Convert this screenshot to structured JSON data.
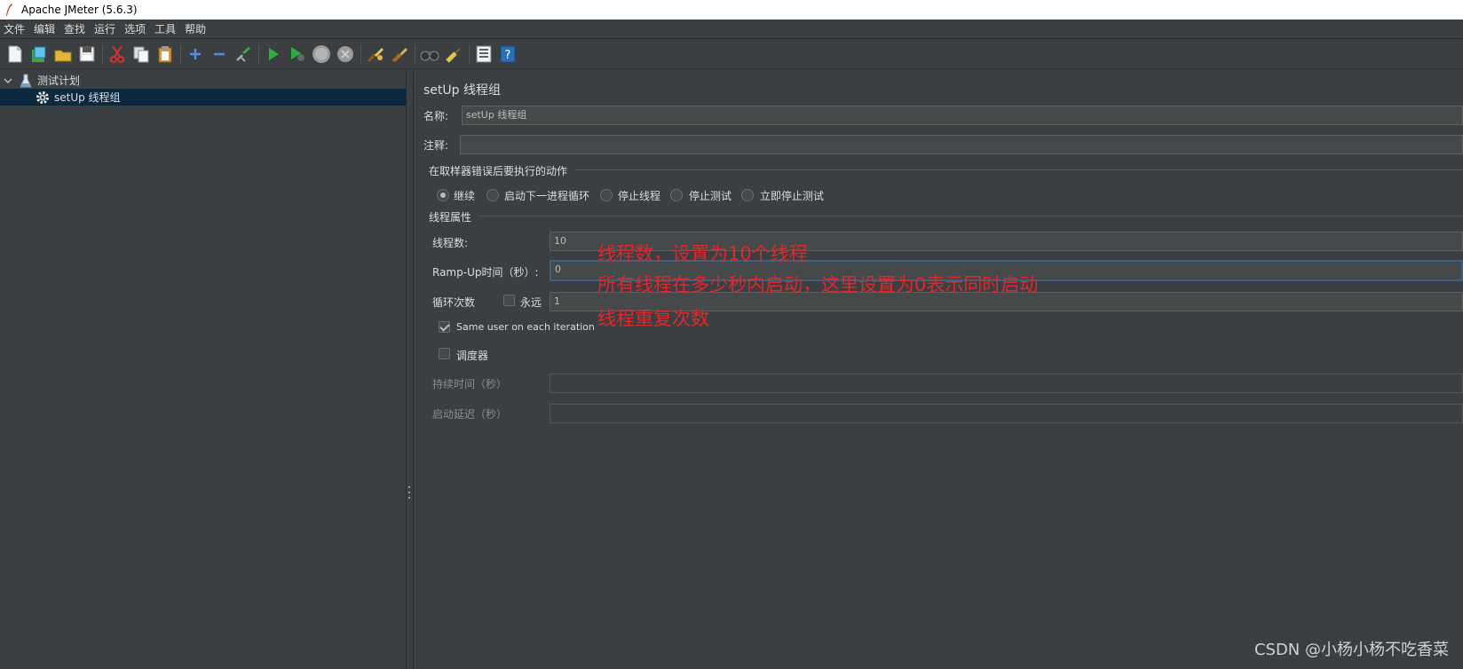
{
  "window": {
    "title": "Apache JMeter (5.6.3)"
  },
  "menubar": {
    "items": [
      "文件",
      "编辑",
      "查找",
      "运行",
      "选项",
      "工具",
      "帮助"
    ]
  },
  "toolbar": {
    "buttons": [
      "new-icon",
      "templates-icon",
      "open-icon",
      "save-icon",
      "cut-icon",
      "copy-icon",
      "paste-icon",
      "expand-icon",
      "collapse-icon",
      "toggle-icon",
      "start-icon",
      "start-no-pause-icon",
      "stop-icon",
      "shutdown-icon",
      "clear-icon",
      "clear-all-icon",
      "search-icon",
      "reset-search-icon",
      "function-helper-icon",
      "help-icon"
    ]
  },
  "tree": {
    "root_label": "测试计划",
    "child_label": "setUp 线程组"
  },
  "panel": {
    "title": "setUp 线程组",
    "name_label": "名称:",
    "name_value": "setUp 线程组",
    "comment_label": "注释:",
    "comment_value": "",
    "error_action_legend": "在取样器错误后要执行的动作",
    "error_actions": [
      "继续",
      "启动下一进程循环",
      "停止线程",
      "停止测试",
      "立即停止测试"
    ],
    "thread_props_legend": "线程属性",
    "threads_label": "线程数:",
    "threads_value": "10",
    "rampup_label": "Ramp-Up时间（秒）:",
    "rampup_value": "0",
    "loop_label": "循环次数",
    "forever_label": "永远",
    "loop_value": "1",
    "same_user_label": "Same user on each iteration",
    "scheduler_label": "调度器",
    "duration_label": "持续时间（秒）",
    "duration_value": "",
    "startup_delay_label": "启动延迟（秒）",
    "startup_delay_value": ""
  },
  "annotations": {
    "threads_note": "线程数，设置为10个线程",
    "rampup_note": "所有线程在多少秒内启动，这里设置为0表示同时启动",
    "loop_note": "线程重复次数"
  },
  "watermark": "CSDN @小杨小杨不吃香菜",
  "colors": {
    "background": "#3c3f41",
    "selection": "#0d293e",
    "annotation": "#e0282c"
  }
}
